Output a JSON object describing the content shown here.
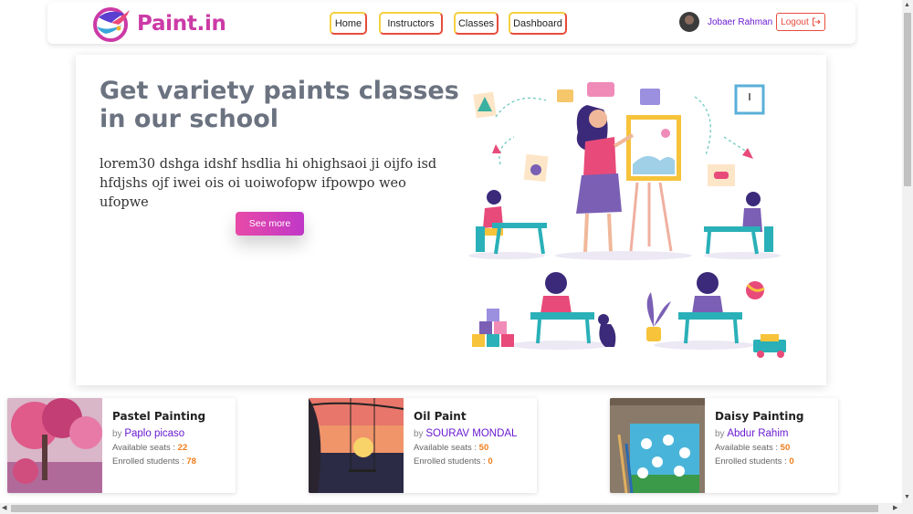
{
  "brand": {
    "name": "Paint.in"
  },
  "nav": {
    "items": [
      {
        "label": "Home"
      },
      {
        "label": "Instructors"
      },
      {
        "label": "Classes"
      },
      {
        "label": "Dashboard"
      }
    ]
  },
  "user": {
    "name": "Jobaer Rahman",
    "logout_label": "Logout",
    "logout_icon": "logout-icon"
  },
  "hero": {
    "title": "Get variety paints classes in our school",
    "text": "lorem30 dshga idshf hsdlia hi ohighsaoi ji oijfo isd hfdjshs ojf iwei ois oi uoiwofopw ifpowpo weo ufopwe",
    "cta_label": "See more"
  },
  "classes": [
    {
      "title": "Pastel Painting",
      "by": "by",
      "instructor": "Paplo picaso",
      "seats_label": "Available seats :",
      "seats": "22",
      "enrolled_label": "Enrolled students :",
      "enrolled": "78"
    },
    {
      "title": "Oil Paint",
      "by": "by",
      "instructor": "SOURAV MONDAL",
      "seats_label": "Available seats :",
      "seats": "50",
      "enrolled_label": "Enrolled students :",
      "enrolled": "0"
    },
    {
      "title": "Daisy Painting",
      "by": "by",
      "instructor": "Abdur Rahim",
      "seats_label": "Available seats :",
      "seats": "50",
      "enrolled_label": "Enrolled students :",
      "enrolled": "0"
    }
  ],
  "colors": {
    "brand": "#cc3aa6",
    "accent": "#6a1bd1",
    "cta": "#e84aa7",
    "number": "#f07d1a",
    "logout": "#e74c3c"
  }
}
